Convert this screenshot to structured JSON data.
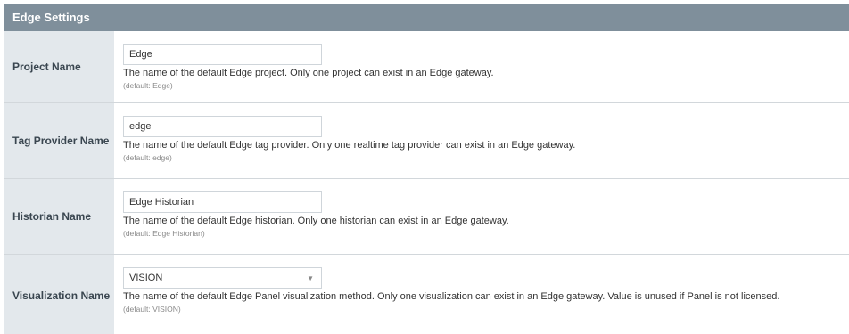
{
  "panel": {
    "title": "Edge Settings"
  },
  "rows": [
    {
      "label": "Project Name",
      "value": "Edge",
      "description": "The name of the default Edge project. Only one project can exist in an Edge gateway.",
      "default": "(default: Edge)"
    },
    {
      "label": "Tag Provider Name",
      "value": "edge",
      "description": "The name of the default Edge tag provider. Only one realtime tag provider can exist in an Edge gateway.",
      "default": "(default: edge)"
    },
    {
      "label": "Historian Name",
      "value": "Edge Historian",
      "description": "The name of the default Edge historian. Only one historian can exist in an Edge gateway.",
      "default": "(default: Edge Historian)"
    },
    {
      "label": "Visualization Name",
      "value": "VISION",
      "description": "The name of the default Edge Panel visualization method. Only one visualization can exist in an Edge gateway. Value is unused if Panel is not licensed.",
      "default": "(default: VISION)"
    }
  ],
  "icons": {
    "dropdown": "chevron-down-icon"
  }
}
